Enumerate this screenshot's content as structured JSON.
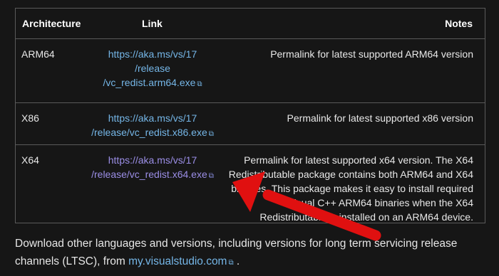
{
  "table": {
    "headers": {
      "architecture": "Architecture",
      "link": "Link",
      "notes": "Notes"
    },
    "rows": [
      {
        "architecture": "ARM64",
        "link_lines": [
          "https://aka.ms/vs/17",
          "/release",
          "/vc_redist.arm64.exe"
        ],
        "notes_lines": [
          "Permalink for latest supported ARM64 version"
        ]
      },
      {
        "architecture": "X86",
        "link_lines": [
          "https://aka.ms/vs/17",
          "/release/vc_redist.x86.exe"
        ],
        "notes_lines": [
          "Permalink for latest supported x86 version"
        ]
      },
      {
        "architecture": "X64",
        "link_lines": [
          "https://aka.ms/vs/17",
          "/release/vc_redist.x64.exe"
        ],
        "notes_lines": [
          "Permalink for latest supported x64 version. The X64",
          "Redistributable package contains both ARM64 and X64",
          "binaries. This package makes it easy to install required",
          "Visual C++ ARM64 binaries when the X64",
          "Redistributable is installed on an ARM64 device."
        ]
      }
    ]
  },
  "footer": {
    "text_before": "Download other languages and versions, including versions for long term servicing release channels (LTSC), from ",
    "link": "my.visualstudio.com",
    "text_after": " ."
  },
  "icons": {
    "external_link": "external-link-icon",
    "annotation": "red-arrow-annotation"
  },
  "colors": {
    "background": "#161616",
    "link": "#75b6e7",
    "visited_link": "#9b8ee6",
    "border": "#5a5a5a",
    "annotation_arrow": "#e01010"
  }
}
